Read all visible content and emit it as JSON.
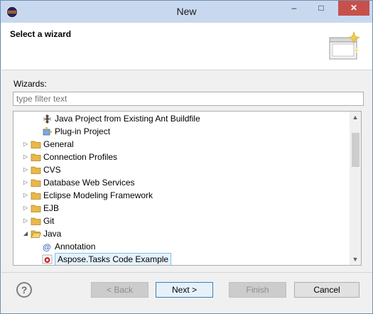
{
  "window": {
    "title": "New",
    "app_icon": "eclipse-icon",
    "close_glyph": "✕",
    "minimize_glyph": "–",
    "maximize_glyph": "□"
  },
  "header": {
    "title": "Select a wizard",
    "icon": "wizard-banner-icon"
  },
  "wizards": {
    "label": "Wizards:",
    "filter_placeholder": "type filter text"
  },
  "tree": {
    "items": [
      {
        "label": "Java Project from Existing Ant Buildfile",
        "icon": "ant-icon",
        "depth": 1,
        "toggle": ""
      },
      {
        "label": "Plug-in Project",
        "icon": "plugin-icon",
        "depth": 1,
        "toggle": ""
      },
      {
        "label": "General",
        "icon": "folder-icon",
        "depth": 0,
        "toggle": "▷"
      },
      {
        "label": "Connection Profiles",
        "icon": "folder-icon",
        "depth": 0,
        "toggle": "▷"
      },
      {
        "label": "CVS",
        "icon": "folder-icon",
        "depth": 0,
        "toggle": "▷"
      },
      {
        "label": "Database Web Services",
        "icon": "folder-icon",
        "depth": 0,
        "toggle": "▷"
      },
      {
        "label": "Eclipse Modeling Framework",
        "icon": "folder-icon",
        "depth": 0,
        "toggle": "▷"
      },
      {
        "label": "EJB",
        "icon": "folder-icon",
        "depth": 0,
        "toggle": "▷"
      },
      {
        "label": "Git",
        "icon": "folder-icon",
        "depth": 0,
        "toggle": "▷"
      },
      {
        "label": "Java",
        "icon": "folder-open-icon",
        "depth": 0,
        "toggle": "◢"
      },
      {
        "label": "Annotation",
        "icon": "annotation-icon",
        "depth": 1,
        "toggle": ""
      },
      {
        "label": "Aspose.Tasks Code Example",
        "icon": "aspose-icon",
        "depth": 1,
        "toggle": "",
        "selected": true
      }
    ]
  },
  "buttons": {
    "help": "?",
    "back": "< Back",
    "next": "Next >",
    "finish": "Finish",
    "cancel": "Cancel"
  },
  "scroll": {
    "up": "▲",
    "down": "▼"
  }
}
